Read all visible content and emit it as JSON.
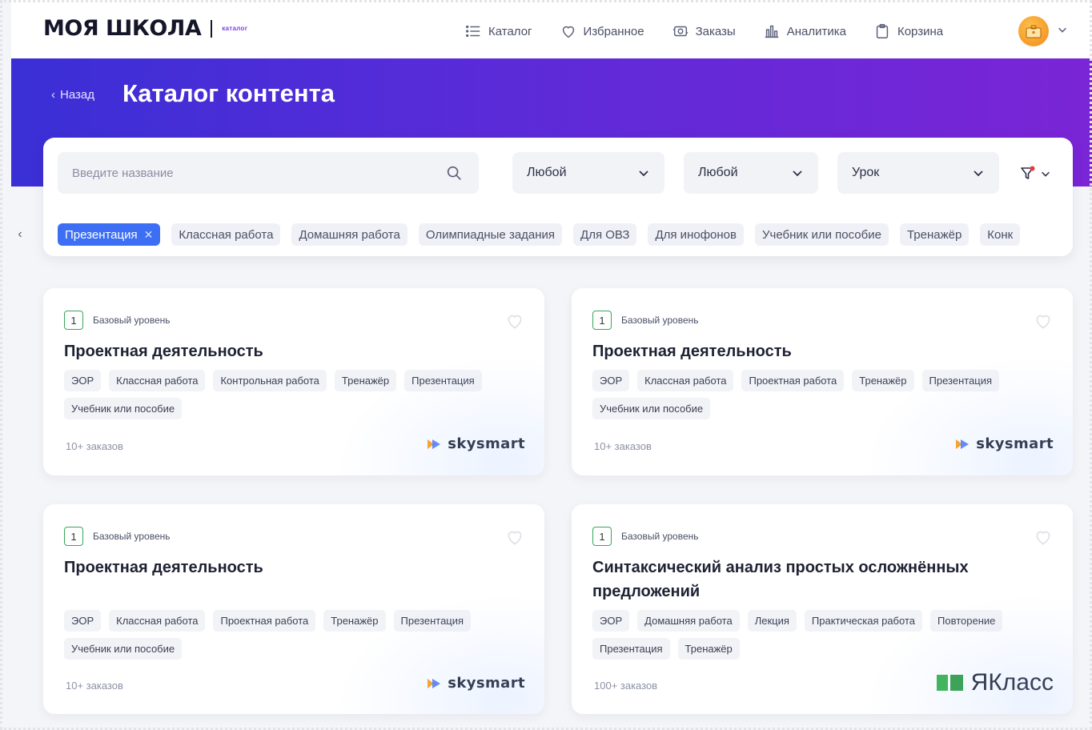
{
  "header": {
    "logo_text": "моя школа",
    "logo_sub": "каталог",
    "nav": [
      {
        "icon": "list-icon",
        "label": "Каталог"
      },
      {
        "icon": "heart-icon",
        "label": "Избранное"
      },
      {
        "icon": "orders-icon",
        "label": "Заказы"
      },
      {
        "icon": "chart-icon",
        "label": "Аналитика"
      },
      {
        "icon": "clipboard-icon",
        "label": "Корзина"
      }
    ]
  },
  "hero": {
    "back_label": "Назад",
    "title": "Каталог контента",
    "gradient_from": "#3a2fd6",
    "gradient_to": "#7a25d6"
  },
  "filters": {
    "search_placeholder": "Введите название",
    "select_1": "Любой",
    "select_2": "Любой",
    "select_3": "Урок",
    "chips": [
      {
        "label": "Презентация",
        "active": true
      },
      {
        "label": "Классная работа",
        "active": false
      },
      {
        "label": "Домашняя работа",
        "active": false
      },
      {
        "label": "Олимпиадные задания",
        "active": false
      },
      {
        "label": "Для ОВЗ",
        "active": false
      },
      {
        "label": "Для инофонов",
        "active": false
      },
      {
        "label": "Учебник или пособие",
        "active": false
      },
      {
        "label": "Тренажёр",
        "active": false
      },
      {
        "label": "Конк",
        "active": false
      }
    ]
  },
  "cards": [
    {
      "level_num": "1",
      "level_text": "Базовый уровень",
      "title": "Проектная деятельность",
      "tags": [
        "ЭОР",
        "Классная работа",
        "Контрольная работа",
        "Тренажёр",
        "Презентация",
        "Учебник или пособие"
      ],
      "orders": "10+ заказов",
      "brand": "skysmart"
    },
    {
      "level_num": "1",
      "level_text": "Базовый уровень",
      "title": "Проектная деятельность",
      "tags": [
        "ЭОР",
        "Классная работа",
        "Проектная работа",
        "Тренажёр",
        "Презентация",
        "Учебник или пособие"
      ],
      "orders": "10+ заказов",
      "brand": "skysmart"
    },
    {
      "level_num": "1",
      "level_text": "Базовый уровень",
      "title": "Проектная деятельность",
      "tags": [
        "ЭОР",
        "Классная работа",
        "Проектная работа",
        "Тренажёр",
        "Презентация",
        "Учебник или пособие"
      ],
      "orders": "10+ заказов",
      "brand": "skysmart"
    },
    {
      "level_num": "1",
      "level_text": "Базовый уровень",
      "title": "Синтаксический анализ простых осложнённых предложений",
      "tags": [
        "ЭОР",
        "Домашняя работа",
        "Лекция",
        "Практическая работа",
        "Повторение",
        "Презентация",
        "Тренажёр"
      ],
      "orders": "100+ заказов",
      "brand": "ЯКласс"
    }
  ],
  "colors": {
    "accent": "#3d6ff5",
    "level_border": "#3aa65a",
    "yaklass_green": "#37b24d",
    "skysmart_orange": "#ff9f1a",
    "skysmart_blue": "#3d6ff5"
  }
}
